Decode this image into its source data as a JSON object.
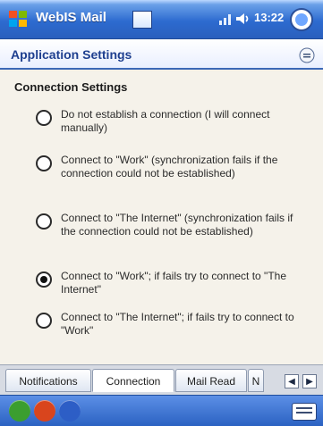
{
  "window": {
    "app_title": "WebIS Mail",
    "clock": "13:22"
  },
  "header": {
    "title": "Application Settings"
  },
  "section": {
    "title": "Connection Settings"
  },
  "options": [
    {
      "label": "Do not establish a connection (I will connect manually)",
      "checked": false
    },
    {
      "label": "Connect to \"Work\" (synchronization fails if the connection could not be established)",
      "checked": false
    },
    {
      "label": "Connect to \"The Internet\" (synchronization fails if the connection could not be established)",
      "checked": false
    },
    {
      "label": "Connect to \"Work\"; if fails try to connect to \"The Internet\"",
      "checked": true
    },
    {
      "label": "Connect to \"The Internet\"; if fails try to connect to \"Work\"",
      "checked": false
    }
  ],
  "tabs": [
    {
      "label": "Notifications",
      "active": false
    },
    {
      "label": "Connection",
      "active": true
    },
    {
      "label": "Mail Read",
      "active": false
    },
    {
      "label": "N",
      "active": false
    }
  ],
  "tab_nav": {
    "left": "◀",
    "right": "▶"
  },
  "colors": {
    "accent": "#2d6bd0",
    "title_text": "#1e3f8f",
    "check": "#111111"
  },
  "icons": [
    "windows-start-icon",
    "app-icon",
    "signal-icon",
    "speaker-icon",
    "ok-icon",
    "menu-icon",
    "keyboard-icon"
  ]
}
